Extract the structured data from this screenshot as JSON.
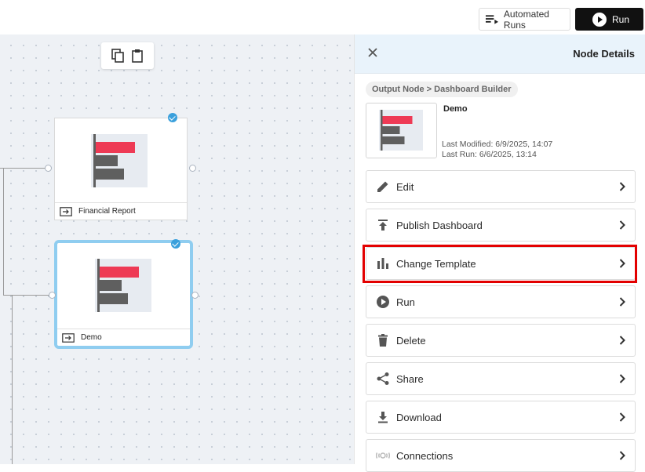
{
  "topbar": {
    "automated_runs_label": "Automated Runs",
    "run_label": "Run"
  },
  "canvas": {
    "toolbar": [
      "copy-icon",
      "paste-icon"
    ],
    "nodes": [
      {
        "label": "Financial Report",
        "selected": false,
        "checked": true
      },
      {
        "label": "Demo",
        "selected": true,
        "checked": true
      }
    ]
  },
  "panel": {
    "title": "Node Details",
    "breadcrumb": "Output Node > Dashboard Builder",
    "node_name": "Demo",
    "last_modified": "Last Modified: 6/9/2025, 14:07",
    "last_run": "Last Run: 6/6/2025, 13:14",
    "actions": [
      {
        "label": "Edit",
        "icon": "pencil-icon"
      },
      {
        "label": "Publish Dashboard",
        "icon": "publish-icon"
      },
      {
        "label": "Change Template",
        "icon": "bar-chart-icon",
        "highlighted": true
      },
      {
        "label": "Run",
        "icon": "play-circle-icon"
      },
      {
        "label": "Delete",
        "icon": "trash-icon"
      },
      {
        "label": "Share",
        "icon": "share-icon"
      },
      {
        "label": "Download",
        "icon": "download-icon"
      },
      {
        "label": "Connections",
        "icon": "connections-icon"
      }
    ]
  },
  "colors": {
    "accent_bar": "#ee3a55",
    "grey_bar": "#5f5f5f",
    "selection_border": "#8fcdf0",
    "highlight": "#e30000",
    "panel_header": "#e9f3fb"
  }
}
